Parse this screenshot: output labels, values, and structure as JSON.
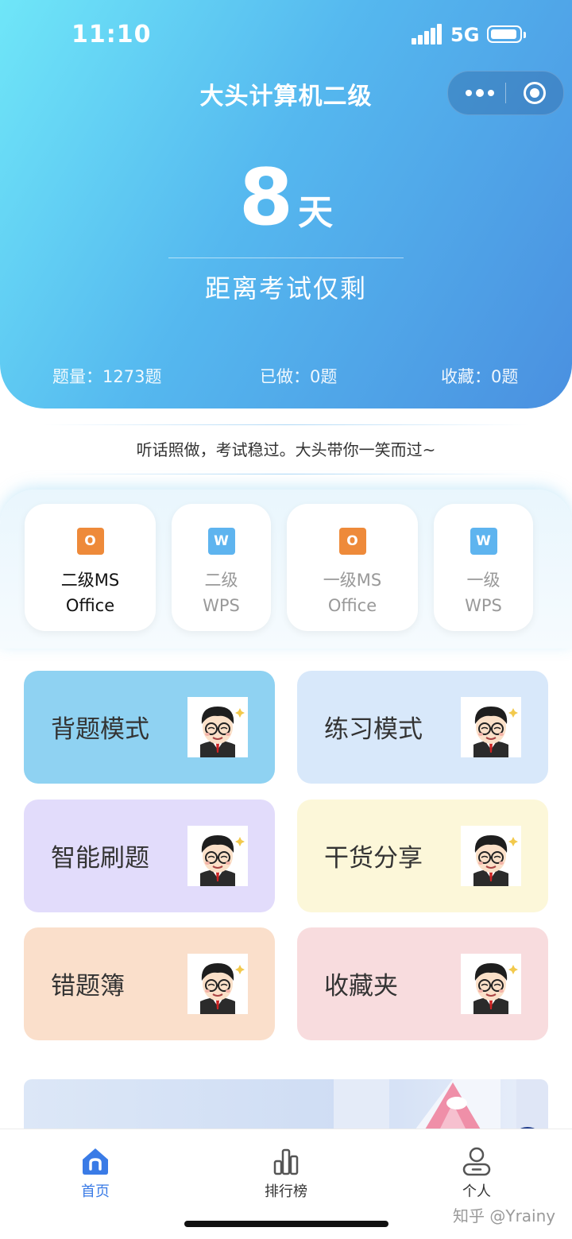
{
  "status_bar": {
    "time": "11:10",
    "network": "5G"
  },
  "header": {
    "title": "大头计算机二级"
  },
  "countdown": {
    "number": "8",
    "unit": "天",
    "subtitle": "距离考试仅剩"
  },
  "stats": {
    "total": "题量：1273题",
    "done": "已做：0题",
    "favorites": "收藏：0题"
  },
  "slogan": "听话照做，考试稳过。大头带你一笑而过~",
  "categories": [
    {
      "line1": "二级MS",
      "line2": "Office",
      "icon": "office-o-icon",
      "icon_letter": "O",
      "active": true
    },
    {
      "line1": "二级",
      "line2": "WPS",
      "icon": "wps-w-icon",
      "icon_letter": "W",
      "active": false
    },
    {
      "line1": "一级MS",
      "line2": "Office",
      "icon": "office-o-icon",
      "icon_letter": "O",
      "active": false
    },
    {
      "line1": "一级",
      "line2": "WPS",
      "icon": "wps-w-icon",
      "icon_letter": "W",
      "active": false
    }
  ],
  "modes": [
    {
      "label": "背题模式",
      "color": "#8fd2f2"
    },
    {
      "label": "练习模式",
      "color": "#d8e8fa"
    },
    {
      "label": "智能刷题",
      "color": "#e2dcfb"
    },
    {
      "label": "干货分享",
      "color": "#fcf7d9"
    },
    {
      "label": "错题簿",
      "color": "#fadfcb"
    },
    {
      "label": "收藏夹",
      "color": "#f8dcde"
    }
  ],
  "tabbar": {
    "home": "首页",
    "ranking": "排行榜",
    "profile": "个人"
  },
  "watermark": "知乎 @Yrainy",
  "colors": {
    "accent": "#3a7be6",
    "hero_start": "#6fe6f8",
    "hero_end": "#4a90e0"
  }
}
